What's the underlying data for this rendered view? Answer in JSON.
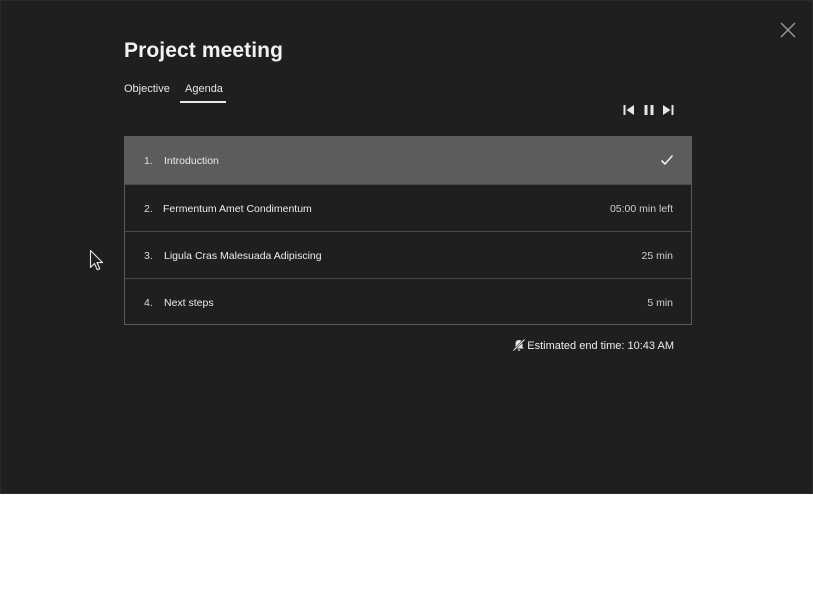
{
  "dialog": {
    "title": "Project meeting"
  },
  "tabs": [
    {
      "label": "Objective",
      "active": false
    },
    {
      "label": "Agenda",
      "active": true
    }
  ],
  "media_controls": {
    "prev_icon": "skip-previous-icon",
    "pause_icon": "pause-icon",
    "next_icon": "skip-next-icon"
  },
  "agenda": {
    "items": [
      {
        "number": "1.",
        "title": "Introduction",
        "meta": "",
        "status": "done",
        "status_icon": "checkmark-icon"
      },
      {
        "number": "2.",
        "title": "Fermentum Amet Condimentum",
        "meta": "05:00 min left",
        "status": "current"
      },
      {
        "number": "3.",
        "title": "Ligula Cras Malesuada Adipiscing",
        "meta": "25 min",
        "status": "upcoming"
      },
      {
        "number": "4.",
        "title": "Next steps",
        "meta": "5 min",
        "status": "upcoming"
      }
    ]
  },
  "estimate": {
    "icon": "notifications-off-icon",
    "text": "Estimated end time: 10:43 AM"
  },
  "icons": {
    "close": "close-icon",
    "cursor": "mouse-pointer-icon"
  },
  "colors": {
    "background": "#1f1f1f",
    "selected_row": "#5c5c5c",
    "text": "#ececec",
    "border": "#5a5a5a"
  }
}
